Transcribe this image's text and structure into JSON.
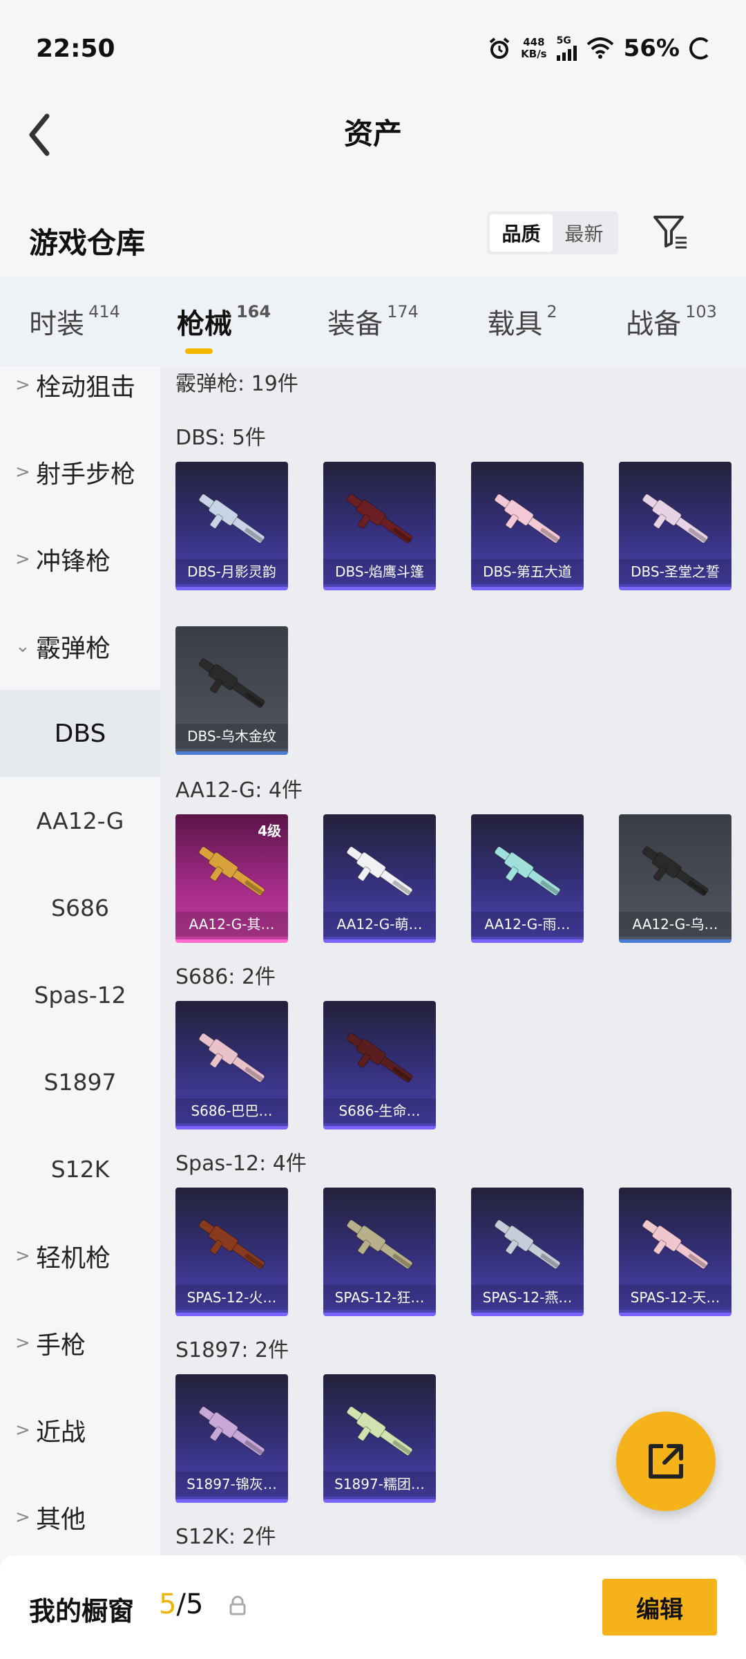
{
  "status_bar": {
    "time": "22:50",
    "net_speed_value": "448",
    "net_speed_unit": "KB/s",
    "network": "5G",
    "battery": "56%"
  },
  "header": {
    "title": "资产"
  },
  "section": {
    "title": "游戏仓库",
    "sort_options": [
      "品质",
      "最新"
    ],
    "sort_active": "品质"
  },
  "tabs": [
    {
      "label": "时装",
      "count": "414"
    },
    {
      "label": "枪械",
      "count": "164"
    },
    {
      "label": "装备",
      "count": "174"
    },
    {
      "label": "载具",
      "count": "2"
    },
    {
      "label": "战备",
      "count": "103"
    }
  ],
  "active_tab": "枪械",
  "sidebar": {
    "items": [
      {
        "label": "栓动狙击",
        "type": "category",
        "expanded": false
      },
      {
        "label": "射手步枪",
        "type": "category",
        "expanded": false
      },
      {
        "label": "冲锋枪",
        "type": "category",
        "expanded": false
      },
      {
        "label": "霰弹枪",
        "type": "category",
        "expanded": true
      },
      {
        "label": "DBS",
        "type": "sub",
        "active": true
      },
      {
        "label": "AA12-G",
        "type": "sub"
      },
      {
        "label": "S686",
        "type": "sub"
      },
      {
        "label": "Spas-12",
        "type": "sub"
      },
      {
        "label": "S1897",
        "type": "sub"
      },
      {
        "label": "S12K",
        "type": "sub"
      },
      {
        "label": "轻机枪",
        "type": "category",
        "expanded": false
      },
      {
        "label": "手枪",
        "type": "category",
        "expanded": false
      },
      {
        "label": "近战",
        "type": "category",
        "expanded": false
      },
      {
        "label": "其他",
        "type": "category",
        "expanded": false
      }
    ]
  },
  "content": {
    "top_label": "霰弹枪: 19件",
    "groups": [
      {
        "label": "DBS: 5件",
        "cards": [
          {
            "name": "DBS-月影灵韵",
            "rarity": "purple",
            "gun_color": "#c9d3e6"
          },
          {
            "name": "DBS-焰鹰斗篷",
            "rarity": "purple",
            "gun_color": "#6b1f22"
          },
          {
            "name": "DBS-第五大道",
            "rarity": "purple",
            "gun_color": "#f2c9d4"
          },
          {
            "name": "DBS-圣堂之誓",
            "rarity": "purple",
            "gun_color": "#e7d2e6"
          },
          {
            "name": "DBS-乌木金纹",
            "rarity": "gray",
            "gun_color": "#2a2a2a"
          }
        ]
      },
      {
        "label": "AA12-G: 4件",
        "cards": [
          {
            "name": "AA12-G-其…",
            "rarity": "pink",
            "level": "4级",
            "gun_color": "#d9a23a"
          },
          {
            "name": "AA12-G-萌…",
            "rarity": "purple",
            "gun_color": "#f1f1f4"
          },
          {
            "name": "AA12-G-雨…",
            "rarity": "purple",
            "gun_color": "#9fe0da"
          },
          {
            "name": "AA12-G-乌…",
            "rarity": "gray",
            "gun_color": "#2a2a2a"
          }
        ]
      },
      {
        "label": "S686: 2件",
        "cards": [
          {
            "name": "S686-巴巴…",
            "rarity": "purple",
            "gun_color": "#e9c2cc"
          },
          {
            "name": "S686-生命…",
            "rarity": "purple",
            "gun_color": "#5a1e1e"
          }
        ]
      },
      {
        "label": "Spas-12: 4件",
        "cards": [
          {
            "name": "SPAS-12-火…",
            "rarity": "purple",
            "gun_color": "#8a3a1e"
          },
          {
            "name": "SPAS-12-狂…",
            "rarity": "purple",
            "gun_color": "#b7b08a"
          },
          {
            "name": "SPAS-12-燕…",
            "rarity": "purple",
            "gun_color": "#c6ccd8"
          },
          {
            "name": "SPAS-12-天…",
            "rarity": "purple",
            "gun_color": "#f0c7cf"
          }
        ]
      },
      {
        "label": "S1897: 2件",
        "cards": [
          {
            "name": "S1897-锦灰…",
            "rarity": "purple",
            "gun_color": "#c7a8d8"
          },
          {
            "name": "S1897-糯团…",
            "rarity": "purple",
            "gun_color": "#cfe2b0"
          }
        ]
      },
      {
        "label": "S12K: 2件",
        "cards": []
      }
    ]
  },
  "bottom_bar": {
    "label": "我的橱窗",
    "current": "5",
    "separator": "/",
    "total": "5",
    "edit_label": "编辑"
  },
  "colors": {
    "accent": "#f6b21a",
    "underline": "#f5b800"
  },
  "icons": {
    "back": "chevron-left-icon",
    "filter": "filter-icon",
    "share": "share-external-icon",
    "lock": "lock-icon"
  }
}
